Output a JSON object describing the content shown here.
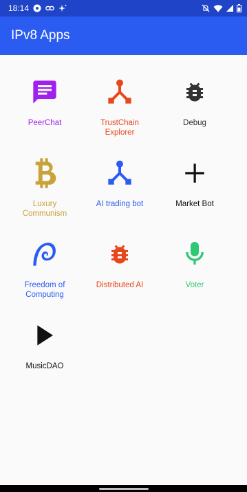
{
  "status_bar": {
    "time": "18:14",
    "icons_left": [
      "notification-dot-icon",
      "link-icon",
      "sparkle-icon"
    ],
    "icons_right": [
      "mute-icon",
      "wifi-icon",
      "signal-icon",
      "battery-icon"
    ]
  },
  "app_bar": {
    "title": "IPv8 Apps",
    "color": "#2b5cf2"
  },
  "apps": [
    {
      "label": "PeerChat",
      "icon": "chat-icon",
      "color": "#a020f0"
    },
    {
      "label": "TrustChain Explorer",
      "icon": "network-icon",
      "color": "#e8471d"
    },
    {
      "label": "Debug",
      "icon": "bug-icon",
      "color": "#333333"
    },
    {
      "label": "Luxury Communism",
      "icon": "bitcoin-icon",
      "color": "#c9a23a"
    },
    {
      "label": "AI trading bot",
      "icon": "network-icon",
      "color": "#2b5cf2"
    },
    {
      "label": "Market Bot",
      "icon": "plus-icon",
      "color": "#111111"
    },
    {
      "label": "Freedom of Computing",
      "icon": "swirl-icon",
      "color": "#2b5cf2"
    },
    {
      "label": "Distributed AI",
      "icon": "bug-icon",
      "color": "#e8471d"
    },
    {
      "label": "Voter",
      "icon": "microphone-icon",
      "color": "#2fc877"
    },
    {
      "label": "MusicDAO",
      "icon": "play-icon",
      "color": "#111111"
    }
  ]
}
